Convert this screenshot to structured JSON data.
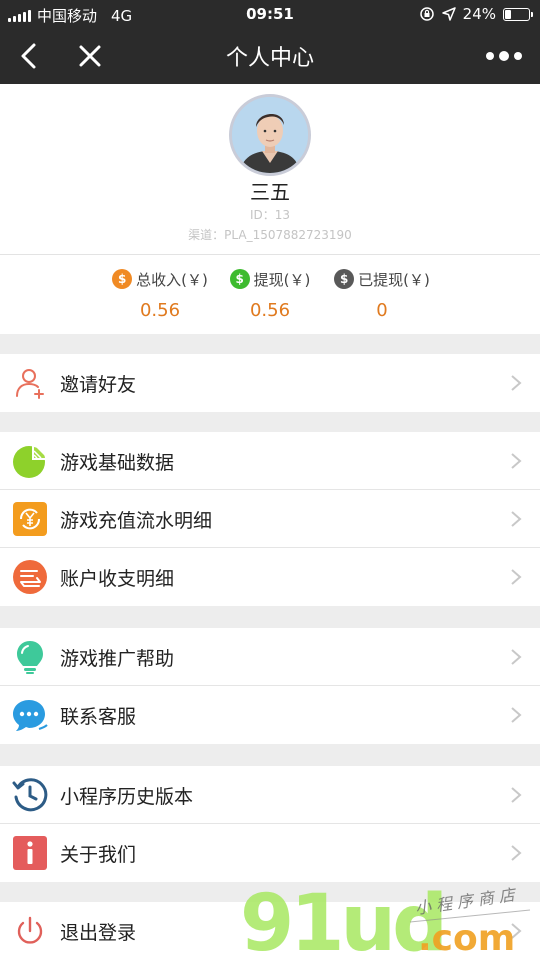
{
  "status_bar": {
    "carrier": "中国移动",
    "network": "4G",
    "time": "09:51",
    "battery": "24%",
    "battery_level": 0.24
  },
  "nav": {
    "title": "个人中心",
    "back_icon": "back-arrow-icon",
    "close_icon": "close-icon",
    "more_icon": "more-dots-icon"
  },
  "profile": {
    "name": "三五",
    "id_text": "ID：13",
    "channel_text": "渠道：PLA_1507882723190"
  },
  "stats": [
    {
      "label": "总收入(￥)",
      "value": "0.56",
      "coin_color": "#f08a24",
      "icon": "coin-icon"
    },
    {
      "label": "提现(￥)",
      "value": "0.56",
      "coin_color": "#3dbb2e",
      "icon": "coin-icon"
    },
    {
      "label": "已提现(￥)",
      "value": "0",
      "coin_color": "#595959",
      "icon": "coin-icon"
    }
  ],
  "menu": {
    "invite": "邀请好友",
    "game_data": "游戏基础数据",
    "recharge_flow": "游戏充值流水明细",
    "account_detail": "账户收支明细",
    "promo_help": "游戏推广帮助",
    "customer_service": "联系客服",
    "history_version": "小程序历史版本",
    "about_us": "关于我们",
    "logout": "退出登录"
  },
  "colors": {
    "nav_background": "#2b2b2b",
    "value_orange": "#e07a1f",
    "page_background": "#ededed"
  },
  "watermark": {
    "brand": "91ud",
    "domain": ".com",
    "tagline": "小程序商店"
  }
}
